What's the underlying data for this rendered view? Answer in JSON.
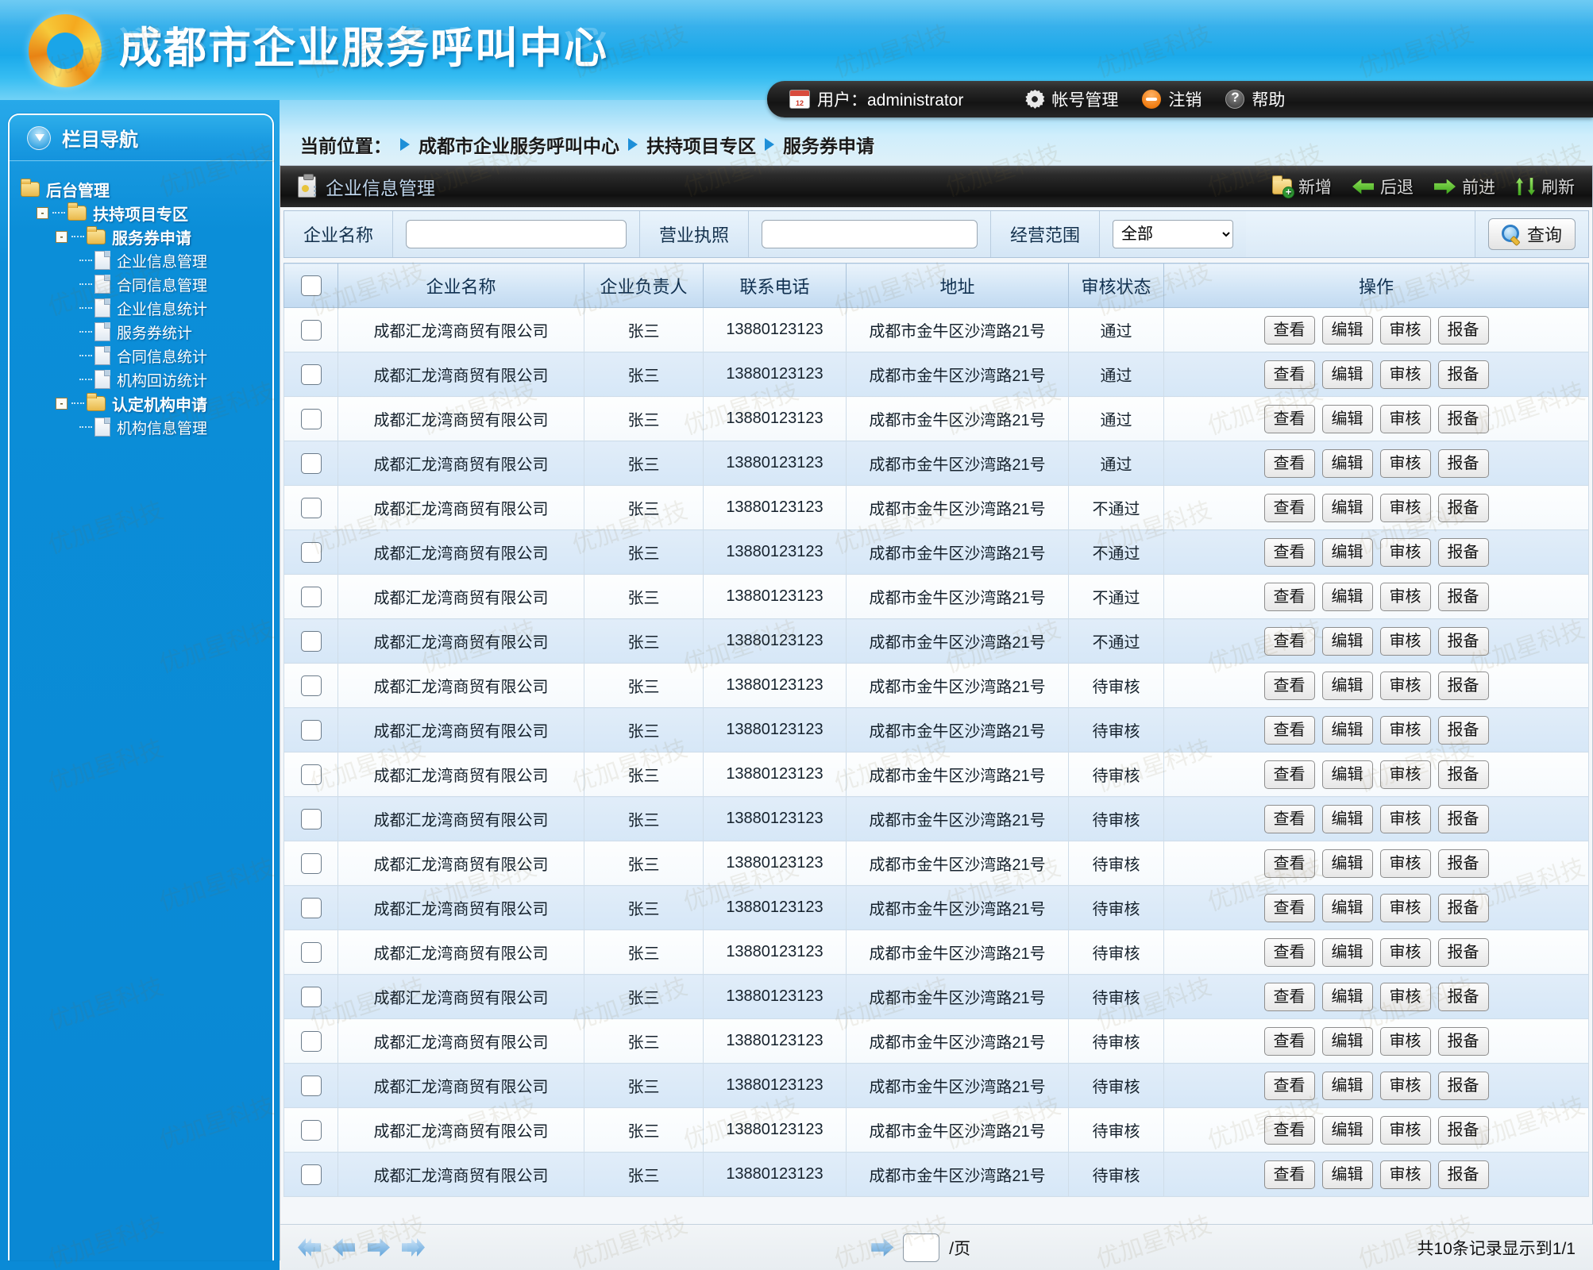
{
  "banner": {
    "title": "成都市企业服务呼叫中心",
    "logo_icon": "swirl-logo-icon"
  },
  "userbar": {
    "calendar_icon": "calendar-icon",
    "user_label": "用户：administrator",
    "gear_icon": "gear-icon",
    "account_label": "帐号管理",
    "logout_icon": "minus-circle-icon",
    "logout_label": "注销",
    "help_icon": "question-icon",
    "help_label": "帮助"
  },
  "sidebar": {
    "nav_icon": "down-circle-icon",
    "title": "栏目导航",
    "tree": [
      {
        "label": "后台管理",
        "level": 0,
        "type": "folder",
        "bold": true,
        "expander": ""
      },
      {
        "label": "扶持项目专区",
        "level": 1,
        "type": "folder",
        "bold": true,
        "expander": "-"
      },
      {
        "label": "服务券申请",
        "level": 2,
        "type": "folder",
        "bold": true,
        "expander": "-"
      },
      {
        "label": "企业信息管理",
        "level": 3,
        "type": "doc",
        "bold": false,
        "expander": ""
      },
      {
        "label": "合同信息管理",
        "level": 3,
        "type": "doc",
        "bold": false,
        "expander": ""
      },
      {
        "label": "企业信息统计",
        "level": 3,
        "type": "doc",
        "bold": false,
        "expander": ""
      },
      {
        "label": "服务券统计",
        "level": 3,
        "type": "doc",
        "bold": false,
        "expander": ""
      },
      {
        "label": "合同信息统计",
        "level": 3,
        "type": "doc",
        "bold": false,
        "expander": ""
      },
      {
        "label": "机构回访统计",
        "level": 3,
        "type": "doc",
        "bold": false,
        "expander": ""
      },
      {
        "label": "认定机构申请",
        "level": 2,
        "type": "folder",
        "bold": true,
        "expander": "-"
      },
      {
        "label": "机构信息管理",
        "level": 3,
        "type": "doc",
        "bold": false,
        "expander": ""
      }
    ]
  },
  "breadcrumb": {
    "prefix": "当前位置：",
    "items": [
      "成都市企业服务呼叫中心",
      "扶持项目专区",
      "服务券申请"
    ]
  },
  "panel": {
    "icon": "clipboard-icon",
    "title": "企业信息管理",
    "toolbar": [
      {
        "label": "新增",
        "icon": "folder-plus-icon"
      },
      {
        "label": "后退",
        "icon": "arrow-left-green-icon"
      },
      {
        "label": "前进",
        "icon": "arrow-right-green-icon"
      },
      {
        "label": "刷新",
        "icon": "refresh-icon"
      }
    ]
  },
  "filter": {
    "name_label": "企业名称",
    "name_value": "",
    "name_placeholder": "",
    "license_label": "营业执照",
    "license_value": "",
    "license_placeholder": "",
    "scope_label": "经营范围",
    "scope_selected": "全部",
    "scope_options": [
      "全部"
    ],
    "search_label": "查询",
    "search_icon": "magnifier-icon"
  },
  "table": {
    "columns": [
      "",
      "企业名称",
      "企业负责人",
      "联系电话",
      "地址",
      "审核状态",
      "操作"
    ],
    "action_labels": [
      "查看",
      "编辑",
      "审核",
      "报备"
    ],
    "rows": [
      {
        "name": "成都汇龙湾商贸有限公司",
        "owner": "张三",
        "phone": "13880123123",
        "address": "成都市金牛区沙湾路21号",
        "status": "通过"
      },
      {
        "name": "成都汇龙湾商贸有限公司",
        "owner": "张三",
        "phone": "13880123123",
        "address": "成都市金牛区沙湾路21号",
        "status": "通过"
      },
      {
        "name": "成都汇龙湾商贸有限公司",
        "owner": "张三",
        "phone": "13880123123",
        "address": "成都市金牛区沙湾路21号",
        "status": "通过"
      },
      {
        "name": "成都汇龙湾商贸有限公司",
        "owner": "张三",
        "phone": "13880123123",
        "address": "成都市金牛区沙湾路21号",
        "status": "通过"
      },
      {
        "name": "成都汇龙湾商贸有限公司",
        "owner": "张三",
        "phone": "13880123123",
        "address": "成都市金牛区沙湾路21号",
        "status": "不通过"
      },
      {
        "name": "成都汇龙湾商贸有限公司",
        "owner": "张三",
        "phone": "13880123123",
        "address": "成都市金牛区沙湾路21号",
        "status": "不通过"
      },
      {
        "name": "成都汇龙湾商贸有限公司",
        "owner": "张三",
        "phone": "13880123123",
        "address": "成都市金牛区沙湾路21号",
        "status": "不通过"
      },
      {
        "name": "成都汇龙湾商贸有限公司",
        "owner": "张三",
        "phone": "13880123123",
        "address": "成都市金牛区沙湾路21号",
        "status": "不通过"
      },
      {
        "name": "成都汇龙湾商贸有限公司",
        "owner": "张三",
        "phone": "13880123123",
        "address": "成都市金牛区沙湾路21号",
        "status": "待审核"
      },
      {
        "name": "成都汇龙湾商贸有限公司",
        "owner": "张三",
        "phone": "13880123123",
        "address": "成都市金牛区沙湾路21号",
        "status": "待审核"
      },
      {
        "name": "成都汇龙湾商贸有限公司",
        "owner": "张三",
        "phone": "13880123123",
        "address": "成都市金牛区沙湾路21号",
        "status": "待审核"
      },
      {
        "name": "成都汇龙湾商贸有限公司",
        "owner": "张三",
        "phone": "13880123123",
        "address": "成都市金牛区沙湾路21号",
        "status": "待审核"
      },
      {
        "name": "成都汇龙湾商贸有限公司",
        "owner": "张三",
        "phone": "13880123123",
        "address": "成都市金牛区沙湾路21号",
        "status": "待审核"
      },
      {
        "name": "成都汇龙湾商贸有限公司",
        "owner": "张三",
        "phone": "13880123123",
        "address": "成都市金牛区沙湾路21号",
        "status": "待审核"
      },
      {
        "name": "成都汇龙湾商贸有限公司",
        "owner": "张三",
        "phone": "13880123123",
        "address": "成都市金牛区沙湾路21号",
        "status": "待审核"
      },
      {
        "name": "成都汇龙湾商贸有限公司",
        "owner": "张三",
        "phone": "13880123123",
        "address": "成都市金牛区沙湾路21号",
        "status": "待审核"
      },
      {
        "name": "成都汇龙湾商贸有限公司",
        "owner": "张三",
        "phone": "13880123123",
        "address": "成都市金牛区沙湾路21号",
        "status": "待审核"
      },
      {
        "name": "成都汇龙湾商贸有限公司",
        "owner": "张三",
        "phone": "13880123123",
        "address": "成都市金牛区沙湾路21号",
        "status": "待审核"
      },
      {
        "name": "成都汇龙湾商贸有限公司",
        "owner": "张三",
        "phone": "13880123123",
        "address": "成都市金牛区沙湾路21号",
        "status": "待审核"
      },
      {
        "name": "成都汇龙湾商贸有限公司",
        "owner": "张三",
        "phone": "13880123123",
        "address": "成都市金牛区沙湾路21号",
        "status": "待审核"
      }
    ]
  },
  "pager": {
    "first_icon": "double-arrow-left-icon",
    "prev_icon": "arrow-left-icon",
    "next_icon": "arrow-right-icon",
    "last_icon": "double-arrow-right-icon",
    "go_icon": "arrow-right-icon",
    "page_value": "",
    "page_unit": "/页",
    "summary": "共10条记录显示到1/1"
  },
  "watermark": {
    "text": "优加星科技"
  }
}
